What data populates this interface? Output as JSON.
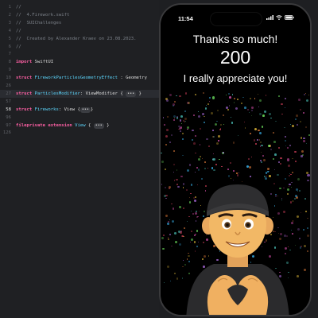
{
  "editor": {
    "lines": [
      {
        "n": "1",
        "segments": [
          {
            "t": "//",
            "c": "comment"
          }
        ]
      },
      {
        "n": "2",
        "segments": [
          {
            "t": "//  4.Firework.swift",
            "c": "comment"
          }
        ]
      },
      {
        "n": "3",
        "segments": [
          {
            "t": "//  SUIChallenges",
            "c": "comment"
          }
        ]
      },
      {
        "n": "4",
        "segments": [
          {
            "t": "//",
            "c": "comment"
          }
        ]
      },
      {
        "n": "5",
        "segments": [
          {
            "t": "//  Created by Alexander Kraev on 23.08.2023.",
            "c": "comment"
          }
        ]
      },
      {
        "n": "6",
        "segments": [
          {
            "t": "//",
            "c": "comment"
          }
        ]
      },
      {
        "n": "7",
        "segments": []
      },
      {
        "n": "8",
        "segments": [
          {
            "t": "import ",
            "c": "kw"
          },
          {
            "t": "SwiftUI",
            "c": "plain"
          }
        ]
      },
      {
        "n": "9",
        "segments": []
      },
      {
        "n": "10",
        "segments": [
          {
            "t": "struct ",
            "c": "kw"
          },
          {
            "t": "FireworkParticlesGeometryEffect",
            "c": "type"
          },
          {
            "t": " : Geometry",
            "c": "plain"
          }
        ]
      },
      {
        "n": "26",
        "segments": []
      },
      {
        "n": "27",
        "segments": [
          {
            "t": "struct ",
            "c": "kw"
          },
          {
            "t": "ParticlesModifier",
            "c": "type"
          },
          {
            "t": ": ViewModifier { ",
            "c": "plain"
          },
          {
            "t": "•••",
            "c": "badge"
          },
          {
            "t": " }",
            "c": "plain"
          }
        ]
      },
      {
        "n": "57",
        "segments": []
      },
      {
        "n": "58",
        "segments": [
          {
            "t": "struct ",
            "c": "kw"
          },
          {
            "t": "Fireworks",
            "c": "type"
          },
          {
            "t": ": View {",
            "c": "plain"
          },
          {
            "t": "•••",
            "c": "badge"
          },
          {
            "t": "}",
            "c": "plain"
          }
        ]
      },
      {
        "n": "96",
        "segments": []
      },
      {
        "n": "97",
        "segments": [
          {
            "t": "fileprivate extension ",
            "c": "kw"
          },
          {
            "t": "View",
            "c": "type"
          },
          {
            "t": " { ",
            "c": "plain"
          },
          {
            "t": "•••",
            "c": "badge"
          },
          {
            "t": " }",
            "c": "plain"
          }
        ]
      },
      {
        "n": "126",
        "segments": []
      }
    ],
    "current_line": "58"
  },
  "phone": {
    "status_time": "11:54",
    "thanks_text": "Thanks so much!",
    "count": "200",
    "appreciate_text": "I really appreciate you!"
  },
  "colors": {
    "particles": [
      "#ff4d6d",
      "#ffd23f",
      "#3ec1ff",
      "#7cff6b",
      "#c77dff",
      "#ff8c42",
      "#5ef2e6",
      "#ff5ecb"
    ]
  }
}
